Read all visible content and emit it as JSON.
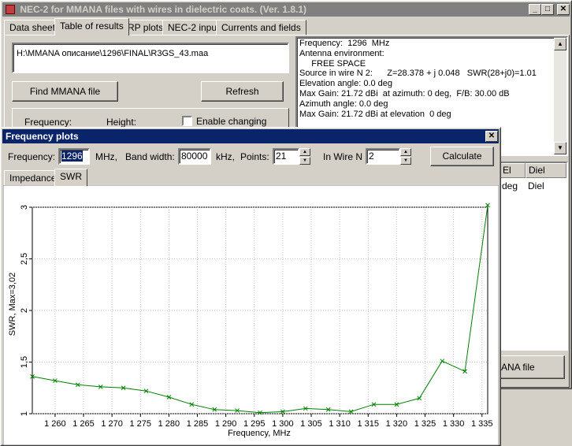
{
  "main_window": {
    "title": "NEC-2 for MMANA files with wires in dielectric coats. (Ver. 1.8.1)",
    "tabs": [
      "Data sheet",
      "Table of results",
      "RP plots",
      "NEC-2 input",
      "Currents and fields"
    ],
    "active_tab": 1,
    "file_path": "H:\\MMANA описание\\1296\\FINAL\\R3GS_43.maa",
    "find_button": "Find MMANA file",
    "refresh_button": "Refresh",
    "frequency_label": "Frequency:",
    "height_label": "Height:",
    "enable_changing_label": "Enable changing",
    "results_lines": [
      "Frequency:  1296  MHz",
      "Antenna environment:",
      "     FREE SPACE",
      "Source in wire N 2:      Z=28.378 + j 0.048   SWR(28+j0)=1.01",
      "Elevation angle: 0.0 deg",
      "Max Gain: 21.72 dBi  at azimuth: 0 deg,  F/B: 30.00 dB",
      "Azimuth angle: 0.0 deg",
      "Max Gain: 21.72 dBi at elevation  0 deg"
    ],
    "table_headers": [
      "El",
      "Diel"
    ],
    "table_row": [
      "deg",
      "Diel"
    ],
    "partial_button": "ANA file"
  },
  "freq_window": {
    "title": "Frequency plots",
    "frequency_label": "Frequency:",
    "frequency_value": "1296",
    "mhz_label": "MHz,",
    "bandwidth_label": "Band width:",
    "bandwidth_value": "80000",
    "khz_label": "kHz,",
    "points_label": "Points:",
    "points_value": "21",
    "wire_label": "In Wire N",
    "wire_value": "2",
    "calculate_button": "Calculate",
    "tabs": [
      "Impedance",
      "SWR"
    ],
    "active_tab": 1
  },
  "colors": {
    "active_title": "#0a246a",
    "inactive_title": "#808080",
    "plot_line": "#008000",
    "grid": "#c0c0c0"
  },
  "chart_data": {
    "type": "line",
    "xlabel": "Frequency, MHz",
    "ylabel": "SWR,  Max=3,02",
    "xlim": [
      1256,
      1336
    ],
    "ylim": [
      1,
      3
    ],
    "x_tick_labels": [
      "1 260",
      "1 265",
      "1 270",
      "1 275",
      "1 280",
      "1 285",
      "1 290",
      "1 295",
      "1 300",
      "1 305",
      "1 310",
      "1 315",
      "1 320",
      "1 325",
      "1 330",
      "1 335"
    ],
    "x_ticks": [
      1260,
      1265,
      1270,
      1275,
      1280,
      1285,
      1290,
      1295,
      1300,
      1305,
      1310,
      1315,
      1320,
      1325,
      1330,
      1335
    ],
    "y_ticks": [
      1,
      1.5,
      2,
      2.5,
      3
    ],
    "y_tick_labels": [
      "1",
      "1,5",
      "2",
      "2,5",
      "3"
    ],
    "grid": true,
    "series": [
      {
        "x": [
          1256,
          1260,
          1264,
          1268,
          1272,
          1276,
          1280,
          1284,
          1288,
          1292,
          1296,
          1300,
          1304,
          1308,
          1312,
          1316,
          1320,
          1324,
          1328,
          1332,
          1336
        ],
        "y": [
          1.36,
          1.32,
          1.28,
          1.26,
          1.25,
          1.22,
          1.16,
          1.09,
          1.04,
          1.03,
          1.01,
          1.02,
          1.05,
          1.04,
          1.02,
          1.09,
          1.09,
          1.15,
          1.51,
          1.41,
          3.02
        ]
      }
    ]
  }
}
